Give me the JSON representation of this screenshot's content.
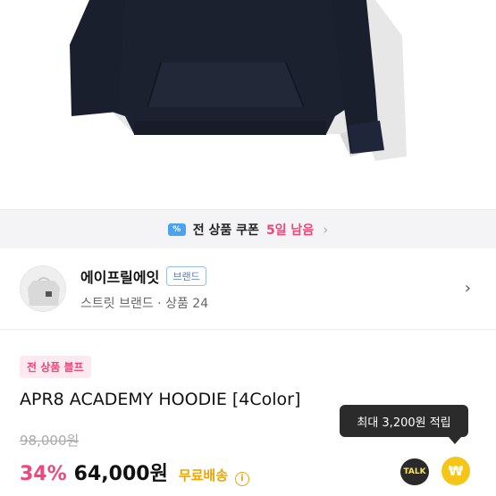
{
  "coupon": {
    "icon": "coupon-ticket-icon",
    "icon_glyph": "%",
    "text": "전 상품 쿠폰",
    "days": "5일 남음",
    "chevron": "›"
  },
  "brand": {
    "name": "에이프릴에잇",
    "badge": "브랜드",
    "sub": "스트릿 브랜드 · 상품 24",
    "chevron": "›"
  },
  "product": {
    "tag": "전 상품 블프",
    "title": "APR8 ACADEMY HOODIE [4Color]",
    "original_price": "98,000원",
    "discount": "34%",
    "price": "64,000원",
    "shipping": "무료배송",
    "info_glyph": "i"
  },
  "tooltip": {
    "text": "최대 3,200원 적립"
  },
  "actions": {
    "talk_label": "TALK",
    "point_glyph": "₩"
  },
  "colors": {
    "accent_pink": "#f0467a",
    "shipping_orange": "#f0a500",
    "badge_blue": "#4a7fd6",
    "hoodie_navy": "#1c2130",
    "hoodie_gray": "#e7e7e7"
  }
}
